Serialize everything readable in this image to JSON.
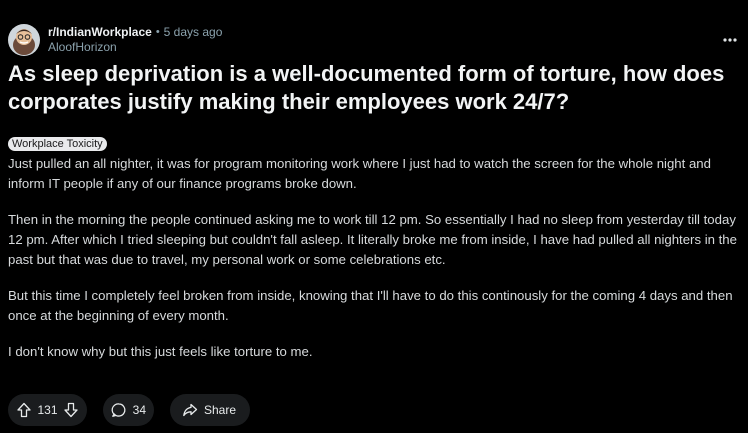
{
  "post": {
    "subreddit": "r/IndianWorkplace",
    "separator": "•",
    "time_ago": "5 days ago",
    "author": "AloofHorizon",
    "more_icon": "more-horizontal-icon",
    "title": "As sleep deprivation is a well-documented form of torture, how does corporates justify making their employees work 24/7?",
    "flair": "Workplace Toxicity",
    "paragraphs": [
      "Just pulled an all nighter, it was for program monitoring work where I just had to watch the screen for the whole night and inform IT people if any of our finance programs broke down.",
      "Then in the morning the people continued asking me to work till 12 pm. So essentially I had no sleep from yesterday till today 12 pm. After which I tried sleeping but couldn't fall asleep. It literally broke me from inside, I have had pulled all nighters in the past but that was due to travel, my personal work or some celebrations etc.",
      "But this time I completely feel broken from inside, knowing that I'll have to do this continously for the coming 4 days and then once at the beginning of every month.",
      "I don't know why but this just feels like torture to me."
    ]
  },
  "actions": {
    "upvote_icon": "upvote-arrow-icon",
    "vote_count": "131",
    "downvote_icon": "downvote-arrow-icon",
    "comment_icon": "comment-bubble-icon",
    "comment_count": "34",
    "share_icon": "share-arrow-icon",
    "share_label": "Share"
  },
  "colors": {
    "background": "#000000",
    "pill_bg": "#1a1c1e",
    "flair_bg": "#e9eaec",
    "meta_text": "#8ba2ad"
  }
}
